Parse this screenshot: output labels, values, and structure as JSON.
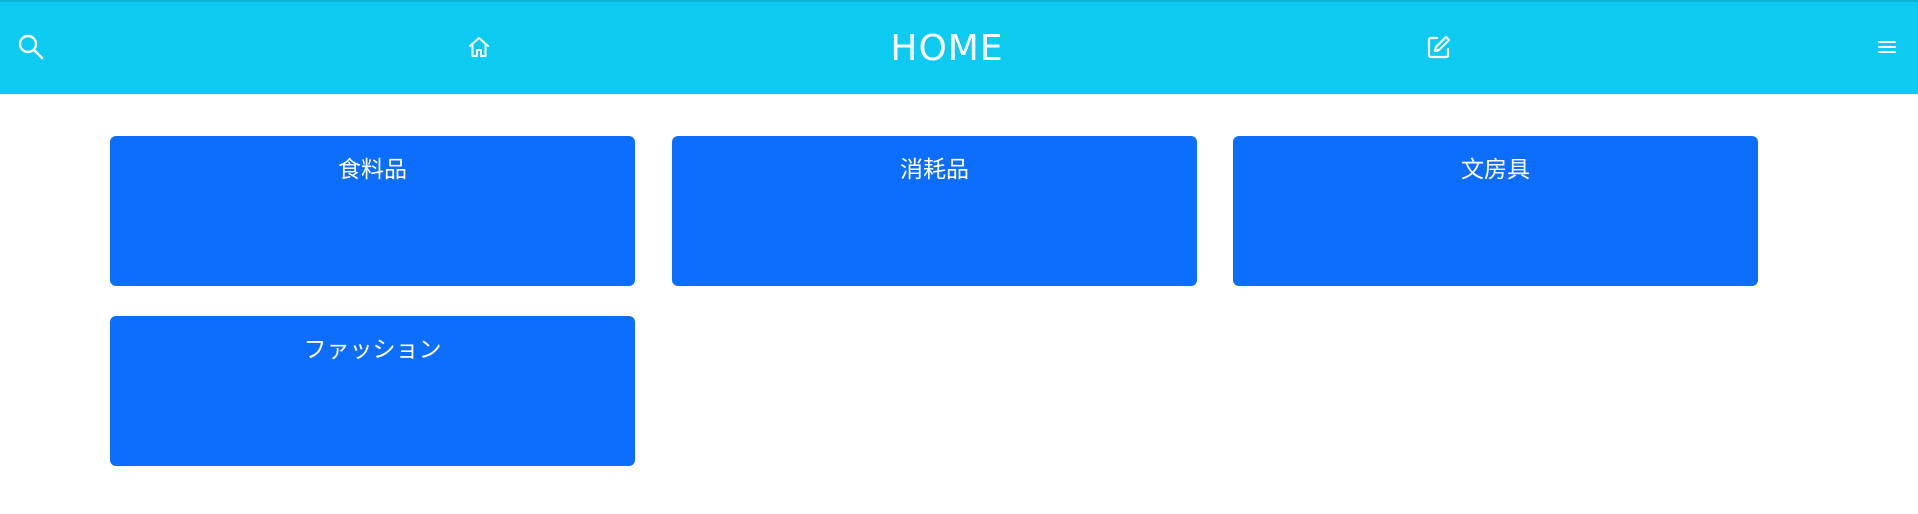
{
  "header": {
    "title": "HOME",
    "bg_color": "#0dcaf0",
    "icons": {
      "search": "search-icon",
      "home": "home-icon",
      "edit": "edit-icon",
      "menu": "menu-icon"
    }
  },
  "categories": {
    "accent_color": "#0d6efd",
    "items": [
      {
        "label": "食料品"
      },
      {
        "label": "消耗品"
      },
      {
        "label": "文房具"
      },
      {
        "label": "ファッション"
      }
    ]
  }
}
